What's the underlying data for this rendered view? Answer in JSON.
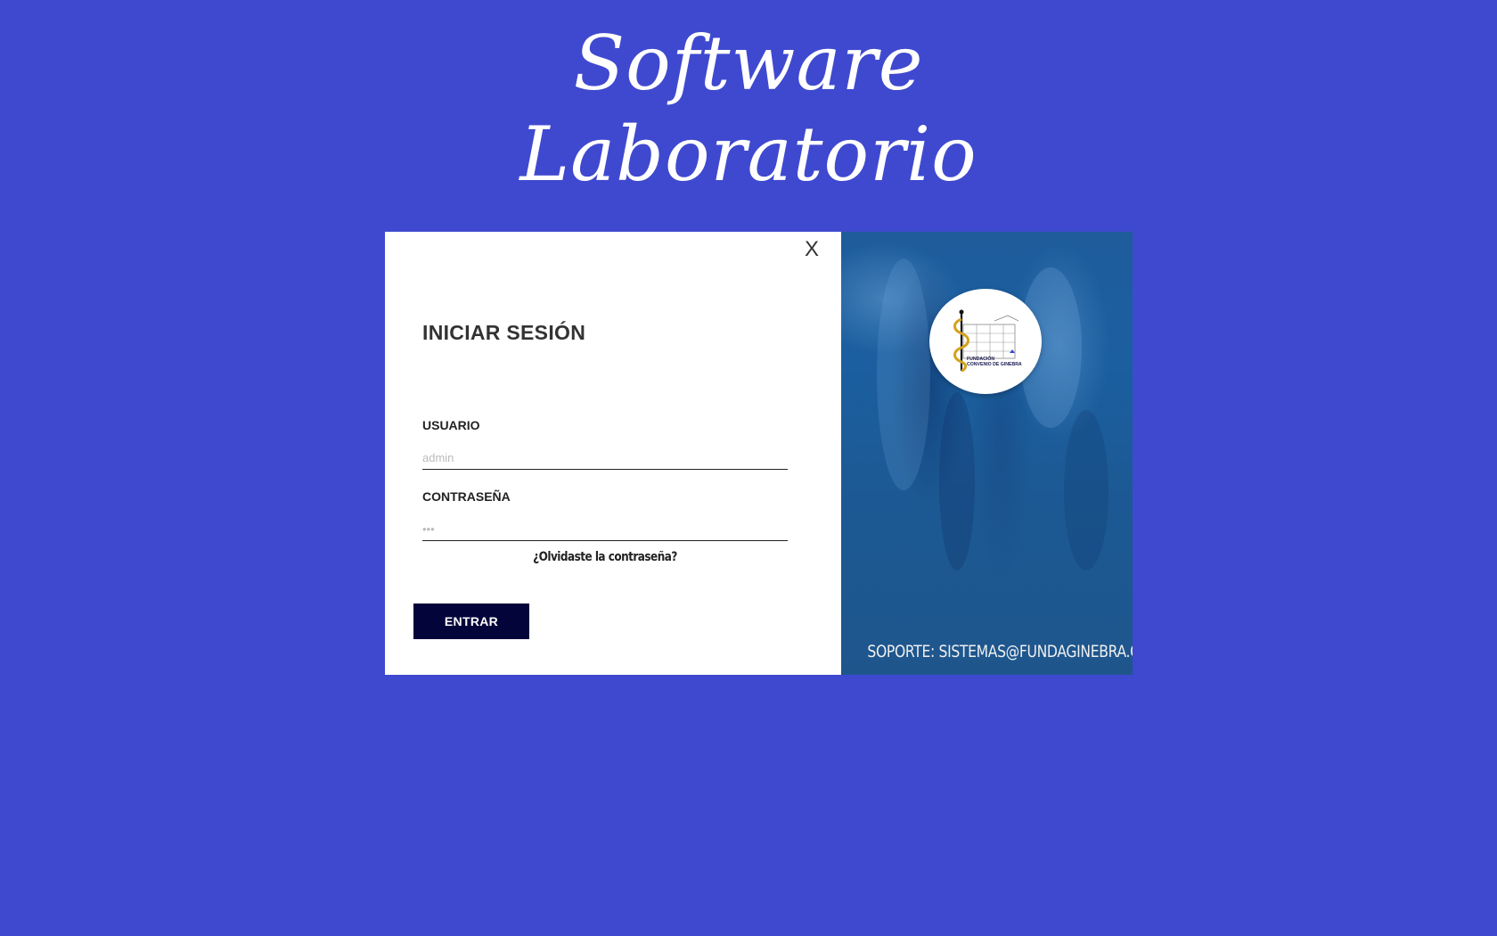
{
  "header": {
    "title_line1": "Software",
    "title_line2": "Laboratorio"
  },
  "login": {
    "close_label": "X",
    "title": "INICIAR SESIÓN",
    "username_label": "USUARIO",
    "username_placeholder": "admin",
    "password_label": "CONTRASEÑA",
    "password_placeholder": "•••",
    "forgot_label": "¿Olvidaste la contraseña?",
    "submit_label": "ENTRAR"
  },
  "side_panel": {
    "logo_text_line1": "FUNDACIÓN",
    "logo_text_line2": "CONVENIO DE GINEBRA",
    "support_text": "SOPORTE: SISTEMAS@FUNDAGINEBRA.COM"
  },
  "colors": {
    "page_background": "#3f49cf",
    "button_background": "#03053a",
    "panel_blue": "#1c5994"
  }
}
